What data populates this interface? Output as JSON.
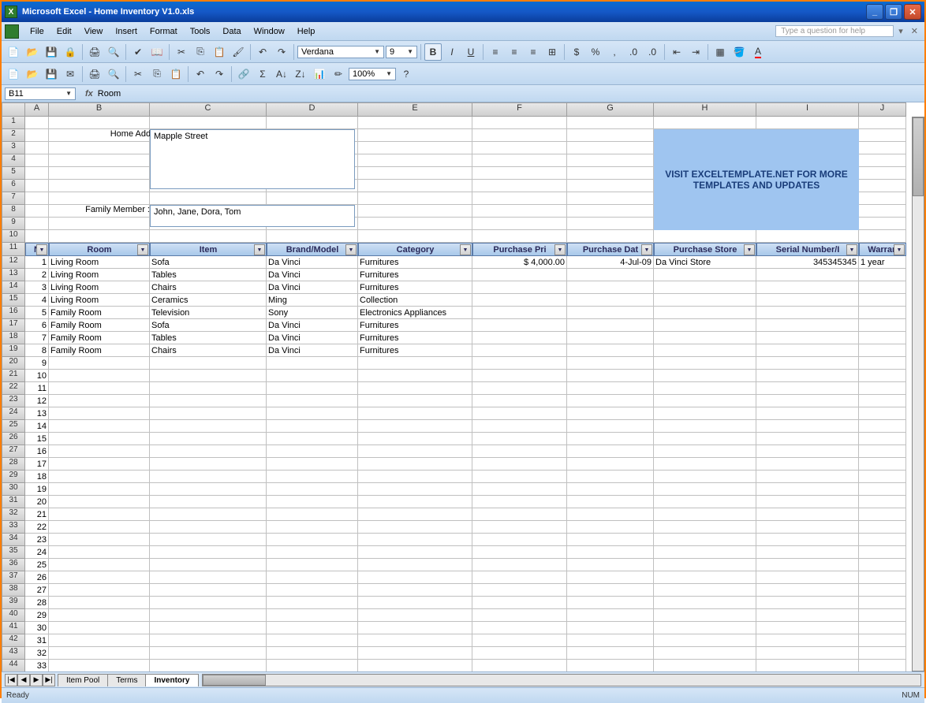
{
  "window": {
    "title": "Microsoft Excel - Home Inventory V1.0.xls"
  },
  "menu": [
    "File",
    "Edit",
    "View",
    "Insert",
    "Format",
    "Tools",
    "Data",
    "Window",
    "Help"
  ],
  "helpbox": "Type a question for help",
  "font": {
    "name": "Verdana",
    "size": "9"
  },
  "toolbar2": {
    "zoom": "100%"
  },
  "namebox": {
    "ref": "B11",
    "fx": "fx",
    "value": "Room"
  },
  "cols": [
    {
      "l": "A",
      "w": 30
    },
    {
      "l": "B",
      "w": 128
    },
    {
      "l": "C",
      "w": 148
    },
    {
      "l": "D",
      "w": 116
    },
    {
      "l": "E",
      "w": 145
    },
    {
      "l": "F",
      "w": 120
    },
    {
      "l": "G",
      "w": 110
    },
    {
      "l": "H",
      "w": 130
    },
    {
      "l": "I",
      "w": 130
    },
    {
      "l": "J",
      "w": 60
    }
  ],
  "labels": {
    "address": "Home Address :",
    "family": "Family Member :"
  },
  "address": "Mapple Street",
  "family": "John, Jane, Dora, Tom",
  "promo": "VISIT EXCELTEMPLATE.NET FOR MORE TEMPLATES AND UPDATES",
  "headers": [
    "N",
    "Room",
    "Item",
    "Brand/Model",
    "Category",
    "Purchase Pri",
    "Purchase Dat",
    "Purchase Store",
    "Serial Number/I",
    "Warran"
  ],
  "data": [
    {
      "n": "1",
      "room": "Living Room",
      "item": "Sofa",
      "brand": "Da Vinci",
      "cat": "Furnitures",
      "price": "$           4,000.00",
      "date": "4-Jul-09",
      "store": "Da Vinci Store",
      "serial": "345345345",
      "warr": "1 year"
    },
    {
      "n": "2",
      "room": "Living Room",
      "item": "Tables",
      "brand": "Da Vinci",
      "cat": "Furnitures",
      "price": "",
      "date": "",
      "store": "",
      "serial": "",
      "warr": ""
    },
    {
      "n": "3",
      "room": "Living Room",
      "item": "Chairs",
      "brand": "Da Vinci",
      "cat": "Furnitures",
      "price": "",
      "date": "",
      "store": "",
      "serial": "",
      "warr": ""
    },
    {
      "n": "4",
      "room": "Living Room",
      "item": "Ceramics",
      "brand": "Ming",
      "cat": "Collection",
      "price": "",
      "date": "",
      "store": "",
      "serial": "",
      "warr": ""
    },
    {
      "n": "5",
      "room": "Family Room",
      "item": "Television",
      "brand": "Sony",
      "cat": "Electronics Appliances",
      "price": "",
      "date": "",
      "store": "",
      "serial": "",
      "warr": ""
    },
    {
      "n": "6",
      "room": "Family Room",
      "item": "Sofa",
      "brand": "Da Vinci",
      "cat": "Furnitures",
      "price": "",
      "date": "",
      "store": "",
      "serial": "",
      "warr": ""
    },
    {
      "n": "7",
      "room": "Family Room",
      "item": "Tables",
      "brand": "Da Vinci",
      "cat": "Furnitures",
      "price": "",
      "date": "",
      "store": "",
      "serial": "",
      "warr": ""
    },
    {
      "n": "8",
      "room": "Family Room",
      "item": "Chairs",
      "brand": "Da Vinci",
      "cat": "Furnitures",
      "price": "",
      "date": "",
      "store": "",
      "serial": "",
      "warr": ""
    }
  ],
  "extraRowStart": 20,
  "extraRowStartNum": 9,
  "tabs": [
    "Item Pool",
    "Terms",
    "Inventory"
  ],
  "activeTab": 2,
  "status": {
    "left": "Ready",
    "right": "NUM"
  }
}
